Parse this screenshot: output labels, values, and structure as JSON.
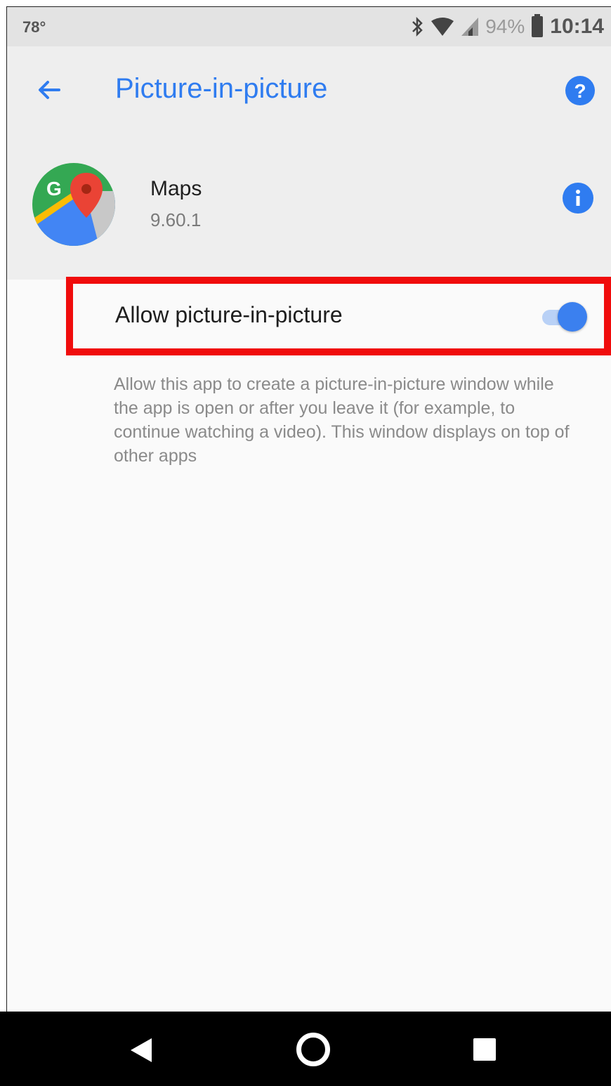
{
  "status_bar": {
    "temperature": "78°",
    "battery_percent": "94%",
    "time": "10:14",
    "icons": [
      "bluetooth-icon",
      "wifi-icon",
      "cell-signal-icon",
      "battery-icon"
    ]
  },
  "toolbar": {
    "title": "Picture-in-picture",
    "back_icon": "arrow-back-icon",
    "help_icon": "help-circle-icon"
  },
  "app": {
    "name": "Maps",
    "version": "9.60.1",
    "icon": "google-maps-icon",
    "info_icon": "info-circle-icon"
  },
  "setting": {
    "label": "Allow picture-in-picture",
    "enabled": true,
    "description": "Allow this app to create a picture-in-picture window while the app is open or after you leave it (for example, to continue watching a video). This window displays on top of other apps"
  },
  "navigation": {
    "icons": [
      "nav-back-icon",
      "nav-home-icon",
      "nav-recents-icon"
    ]
  },
  "colors": {
    "accent": "#2f7cf0",
    "highlight_border": "#f00c0c",
    "header_bg": "#eeeeee"
  }
}
